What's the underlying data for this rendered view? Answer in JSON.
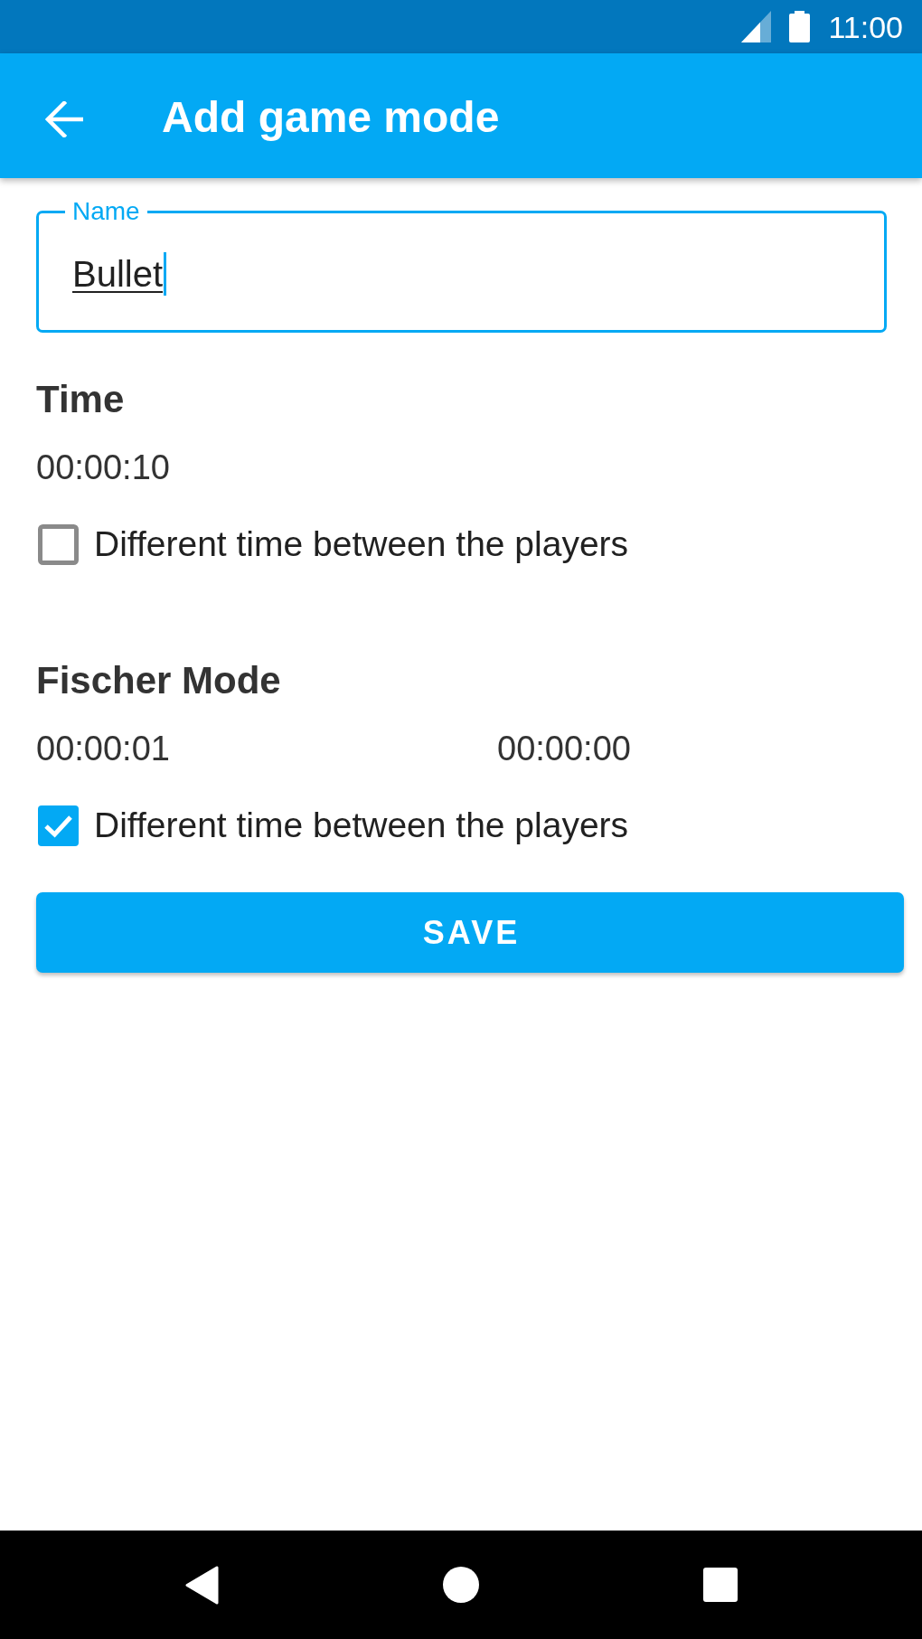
{
  "status_bar": {
    "time": "11:00"
  },
  "app_bar": {
    "title": "Add game mode"
  },
  "name_field": {
    "label": "Name",
    "value": "Bullet",
    "focused": true
  },
  "sections": [
    {
      "title": "Time",
      "times": [
        "00:00:10"
      ],
      "checkbox": {
        "label": "Different time between the players",
        "checked": false
      }
    },
    {
      "title": "Fischer Mode",
      "times": [
        "00:00:01",
        "00:00:00"
      ],
      "checkbox": {
        "label": "Different time between the players",
        "checked": true
      }
    }
  ],
  "save_button": {
    "label": "SAVE"
  }
}
